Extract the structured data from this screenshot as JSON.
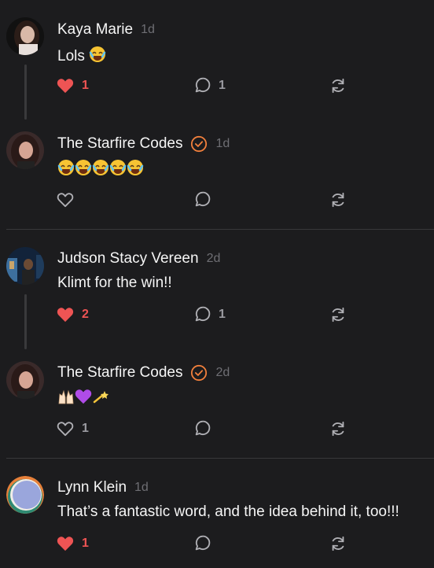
{
  "posts": [
    {
      "author": "Kaya Marie",
      "time": "1d",
      "text": "Lols",
      "emojis": [
        "laughing-emoji"
      ],
      "likes": "1",
      "liked": true,
      "replies": "1",
      "verified": false
    },
    {
      "author": "The Starfire Codes",
      "time": "1d",
      "text": "",
      "emojis": [
        "laughing-emoji",
        "laughing-emoji",
        "laughing-emoji",
        "laughing-emoji",
        "laughing-emoji"
      ],
      "likes": "",
      "liked": false,
      "replies": "",
      "verified": true
    },
    {
      "author": "Judson Stacy Vereen",
      "time": "2d",
      "text": "Klimt for the win!!",
      "emojis": [],
      "likes": "2",
      "liked": true,
      "replies": "1",
      "verified": false
    },
    {
      "author": "The Starfire Codes",
      "time": "2d",
      "text": "",
      "emojis": [
        "raised-hands-emoji",
        "purple-heart-emoji",
        "dizzy-emoji"
      ],
      "likes": "1",
      "liked": false,
      "replies": "",
      "verified": true
    },
    {
      "author": "Lynn Klein",
      "time": "1d",
      "text": "That’s a fantastic word, and the idea behind it, too!!!",
      "emojis": [],
      "likes": "1",
      "liked": true,
      "replies": "",
      "verified": false
    }
  ],
  "colors": {
    "background": "#1c1c1e",
    "like_red": "#ee5454",
    "verified_orange": "#f07f3c",
    "icon_gray": "#9a9aa0",
    "time_gray": "#6e6e73"
  }
}
